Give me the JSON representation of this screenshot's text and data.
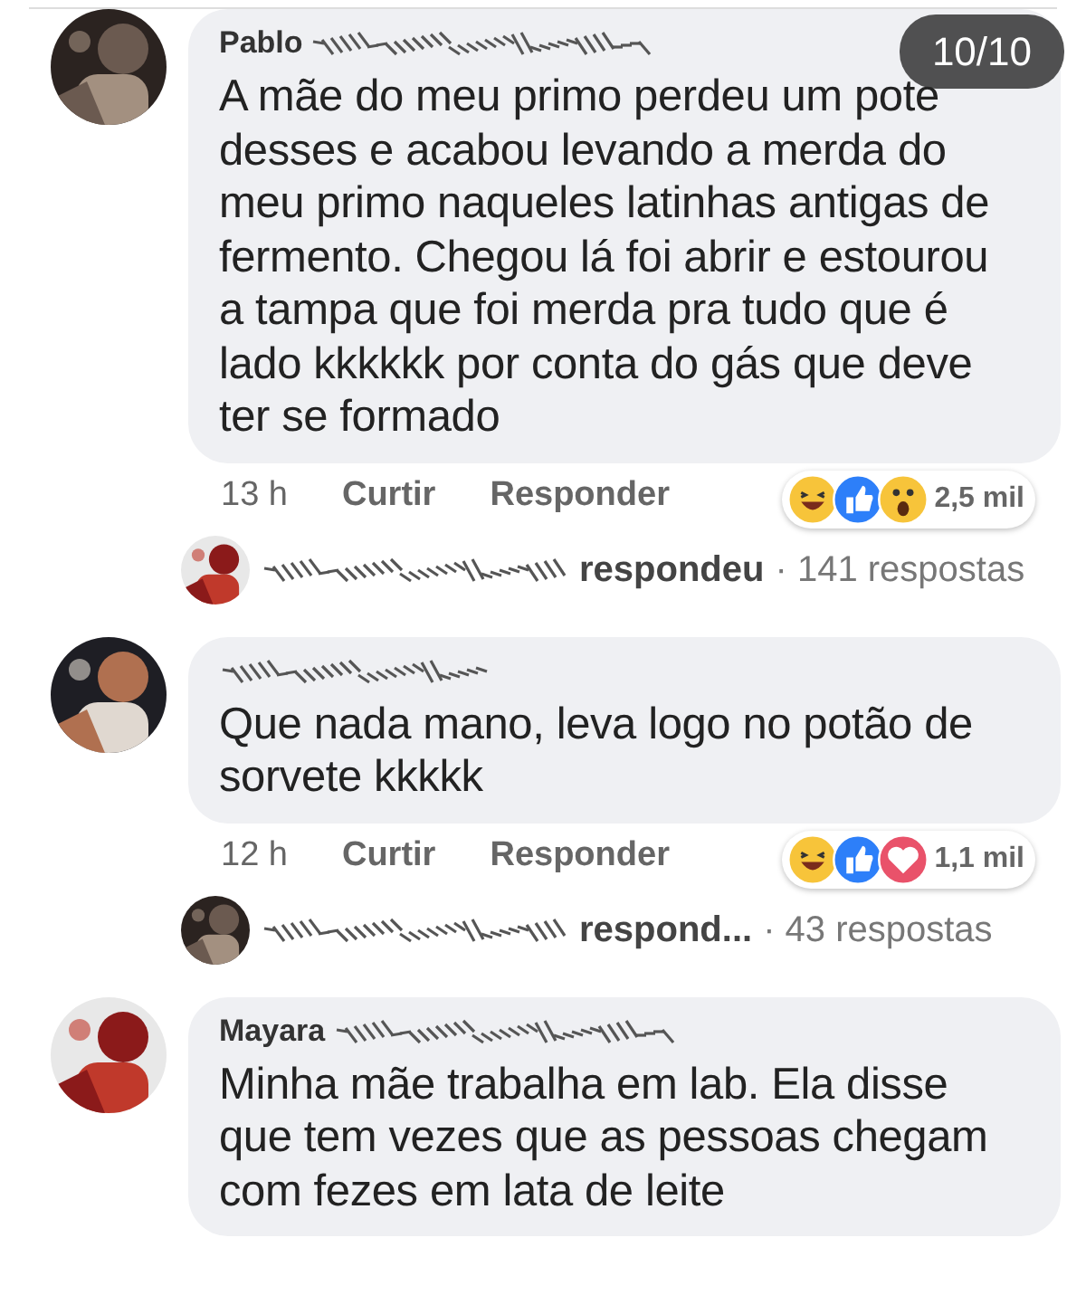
{
  "counter": "10/10",
  "thread": [
    {
      "kind": "comment",
      "name": "Pablo",
      "name_blurred": true,
      "text": "A mãe do meu primo perdeu um pote desses e acabou levando a merda do meu primo naqueles latinhas antigas de fermento. Chegou lá foi abrir e estourou a tampa que foi merda pra tudo que é lado kkkkkk por conta do gás que deve ter se formado",
      "time": "13 h",
      "like": "Curtir",
      "reply": "Responder",
      "reactions": [
        {
          "kind": "haha"
        },
        {
          "kind": "like"
        },
        {
          "kind": "wow"
        }
      ],
      "reaction_count": "2,5 mil"
    },
    {
      "kind": "replies",
      "name_blurred": true,
      "verb": "respondeu",
      "count": "· 141 respostas"
    },
    {
      "kind": "comment",
      "name_blurred": true,
      "text": "Que nada mano, leva logo no potão de sorvete kkkkk",
      "time": "12 h",
      "like": "Curtir",
      "reply": "Responder",
      "reactions": [
        {
          "kind": "haha"
        },
        {
          "kind": "like"
        },
        {
          "kind": "love"
        }
      ],
      "reaction_count": "1,1 mil"
    },
    {
      "kind": "replies",
      "name_blurred": true,
      "verb": "respond...",
      "count": "· 43 respostas"
    },
    {
      "kind": "comment",
      "name": "Mayara",
      "name_blurred": true,
      "text": "Minha mãe trabalha em lab. Ela disse que tem vezes que as pessoas chegam com fezes em lata de leite"
    }
  ]
}
